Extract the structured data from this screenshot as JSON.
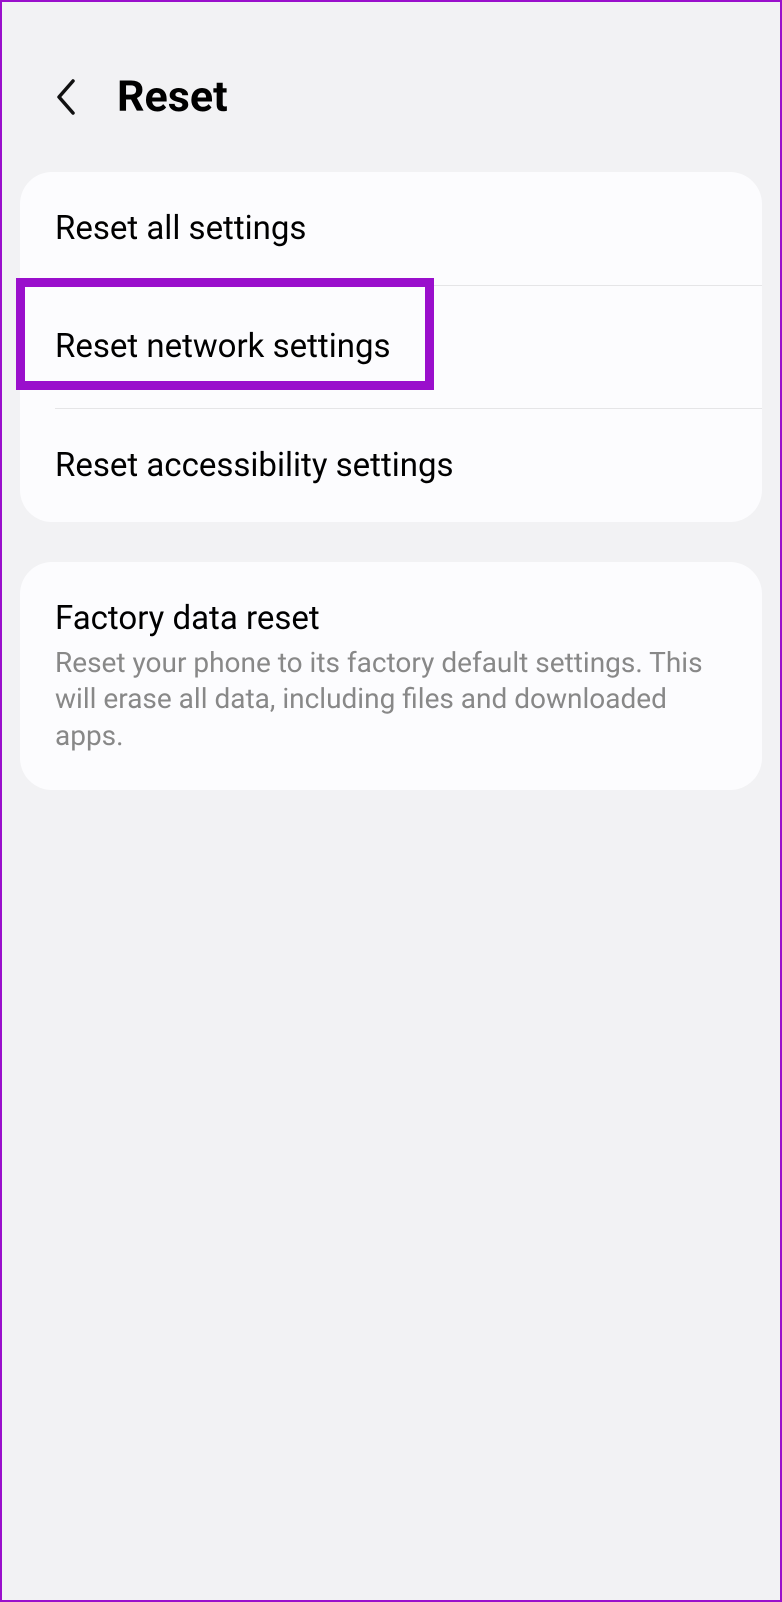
{
  "header": {
    "title": "Reset"
  },
  "group1": {
    "items": [
      {
        "title": "Reset all settings"
      },
      {
        "title": "Reset network settings"
      },
      {
        "title": "Reset accessibility settings"
      }
    ]
  },
  "group2": {
    "items": [
      {
        "title": "Factory data reset",
        "subtitle": "Reset your phone to its factory default settings. This will erase all data, including files and downloaded apps."
      }
    ]
  },
  "colors": {
    "highlight": "#9a0fcc",
    "background": "#f2f2f4",
    "card": "#fcfcfe"
  }
}
